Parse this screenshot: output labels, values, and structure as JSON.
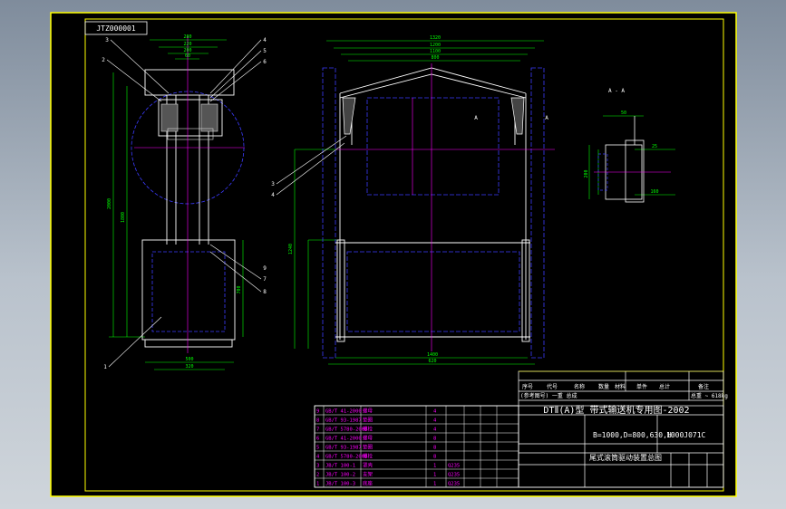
{
  "colors": {
    "background_top": "#7f8c9c",
    "background_bottom": "#cfd5db",
    "sheet": "#000000",
    "border": "#ffff00",
    "outline": "#ffffff",
    "dimension": "#00ff00",
    "centerline": "#ff00ff",
    "hidden": "#3b3bff",
    "annotation": "#ffffff",
    "title_text": "#ffffff",
    "table_text": "#ff00ff"
  },
  "drawing": {
    "code_box": "JTZ000001",
    "section_label": "A - A",
    "section_marks": [
      "A",
      "A"
    ],
    "dims_side": [
      "280",
      "220",
      "200",
      "60",
      "2000",
      "1800",
      "700",
      "500",
      "320"
    ],
    "dims_front": [
      "1320",
      "1200",
      "1100",
      "800",
      "1240",
      "1400",
      "620"
    ],
    "dims_section": [
      "50",
      "25",
      "200",
      "160"
    ],
    "balloons_left": [
      "3",
      "2",
      "1",
      "4",
      "5",
      "6"
    ],
    "balloons_right": [
      "7",
      "8",
      "9"
    ],
    "balloons_mid": [
      "3",
      "4"
    ]
  },
  "title_block": {
    "title": "DTⅡ(A)型 带式输送机专用图-2002",
    "spec": "B=1000,D=800,630,H",
    "drawing_no": "1000J071C",
    "part_name": "尾式滚筒驱动装置总图",
    "row_labels": [
      "序号",
      "代号",
      "名称",
      "数量",
      "材料",
      "单件",
      "总计",
      "备注"
    ],
    "weight": "总重 ~ 618kg",
    "header_note": "(参考图号) 一重 总成"
  },
  "parts_table": [
    {
      "no": "9",
      "code": "GB/T 41-2000",
      "name": "螺母",
      "qty": "4",
      "mat": "",
      "mass": ""
    },
    {
      "no": "8",
      "code": "GB/T 93-1987",
      "name": "垫圈",
      "qty": "4",
      "mat": "",
      "mass": ""
    },
    {
      "no": "7",
      "code": "GB/T 5780-2000",
      "name": "螺栓",
      "qty": "4",
      "mat": "",
      "mass": ""
    },
    {
      "no": "6",
      "code": "GB/T 41-2000",
      "name": "螺母",
      "qty": "8",
      "mat": "",
      "mass": ""
    },
    {
      "no": "5",
      "code": "GB/T 93-1987",
      "name": "垫圈",
      "qty": "8",
      "mat": "",
      "mass": ""
    },
    {
      "no": "4",
      "code": "GB/T 5780-2000",
      "name": "螺栓",
      "qty": "8",
      "mat": "",
      "mass": ""
    },
    {
      "no": "3",
      "code": "JB/T 100-1",
      "name": "罩壳",
      "qty": "1",
      "mat": "Q235",
      "mass": ""
    },
    {
      "no": "2",
      "code": "JB/T 100-2",
      "name": "支架",
      "qty": "1",
      "mat": "Q235",
      "mass": ""
    },
    {
      "no": "1",
      "code": "JB/T 100-3",
      "name": "底座",
      "qty": "1",
      "mat": "Q235",
      "mass": ""
    }
  ]
}
